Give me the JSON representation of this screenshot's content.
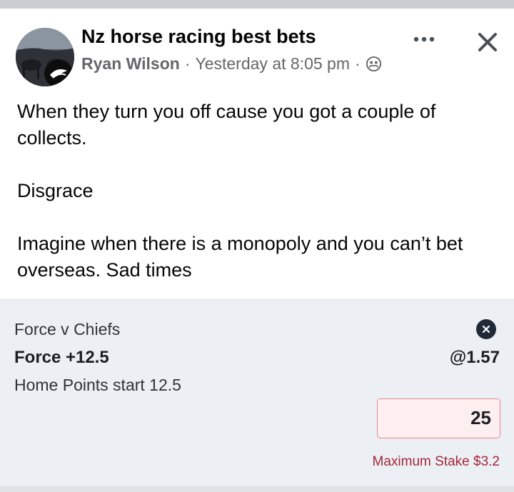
{
  "post": {
    "group_name": "Nz horse racing best bets",
    "author": "Ryan Wilson",
    "separator": "·",
    "timestamp": "Yesterday at 8:05 pm",
    "privacy_icon": "group-members-icon",
    "more_icon": "more-options-icon",
    "close_icon": "close-icon",
    "body": {
      "line1": "When they turn you off cause you got a couple of collects.",
      "line2": "Disgrace",
      "line3": "Imagine when there is a monopoly and you can’t bet overseas. Sad times"
    }
  },
  "bet_slip": {
    "match": "Force v Chiefs",
    "selection": "Force +12.5",
    "market": "Home Points start 12.5",
    "odds": "@1.57",
    "stake_value": "25",
    "max_stake": "Maximum Stake $3.2",
    "remove_icon": "remove-bet-icon"
  },
  "colors": {
    "text_primary": "#050505",
    "text_secondary": "#65676b",
    "slip_background": "#eceff3",
    "stake_border": "#e5878f",
    "stake_background": "#fdeef0",
    "warning_text": "#a3283b"
  }
}
